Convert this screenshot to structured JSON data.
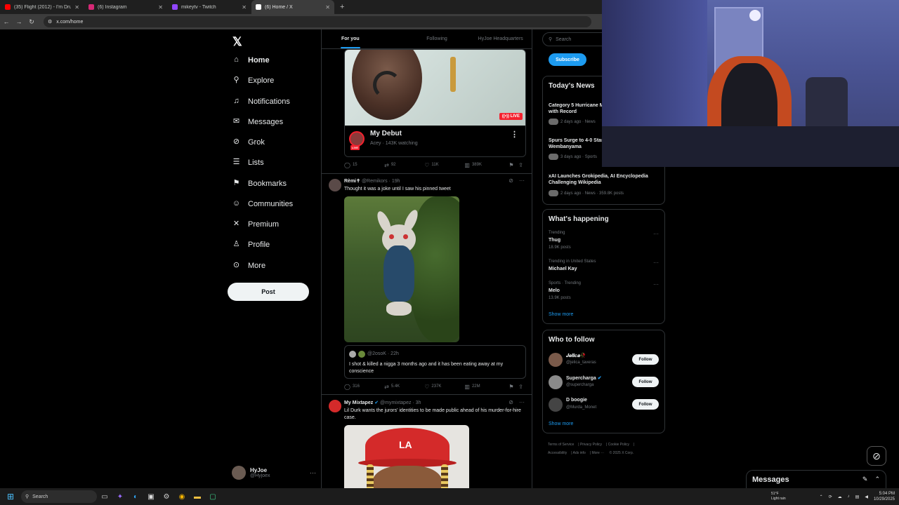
{
  "browser": {
    "tabs": [
      {
        "title": "(35) Flight (2012) - I'm Drunk R",
        "color": "#ff0000"
      },
      {
        "title": "(6) Instagram",
        "color": "#d62976"
      },
      {
        "title": "mikeytv - Twitch",
        "color": "#9146ff"
      },
      {
        "title": "(6) Home / X",
        "color": "#ffffff"
      }
    ],
    "active_tab": 3,
    "url": "x.com/home"
  },
  "nav": {
    "logo": "𝕏",
    "items": [
      {
        "label": "Home",
        "icon": "home-icon"
      },
      {
        "label": "Explore",
        "icon": "search-icon"
      },
      {
        "label": "Notifications",
        "icon": "bell-icon"
      },
      {
        "label": "Messages",
        "icon": "mail-icon"
      },
      {
        "label": "Grok",
        "icon": "grok-icon"
      },
      {
        "label": "Lists",
        "icon": "list-icon"
      },
      {
        "label": "Bookmarks",
        "icon": "bookmark-icon"
      },
      {
        "label": "Communities",
        "icon": "people-icon"
      },
      {
        "label": "Premium",
        "icon": "x-icon"
      },
      {
        "label": "Profile",
        "icon": "person-icon"
      },
      {
        "label": "More",
        "icon": "more-icon"
      }
    ],
    "post_label": "Post",
    "account": {
      "name": "HyJoe",
      "handle": "@Hyjoex"
    }
  },
  "timeline": {
    "tabs": [
      "For you",
      "Following",
      "HyJoe Headquarters"
    ],
    "live": {
      "badge": "LIVE",
      "title": "My Debut",
      "sub": "Acey · 143K watching",
      "avatar_badge": "LIVE",
      "stats": {
        "replies": "15",
        "reposts": "92",
        "likes": "11K",
        "views": "389K"
      }
    },
    "tweet1": {
      "name": "Rèmi✝",
      "meta": "@Remikors · 19h",
      "text": "Thought it was a joke until I saw his pinned tweet",
      "quote": {
        "meta": "@2osoK · 22h",
        "text": "I shot & killed a nigga 3 months ago and it has been eating away at my conscience"
      },
      "stats": {
        "replies": "316",
        "reposts": "5.4K",
        "likes": "237K",
        "views": "22M"
      }
    },
    "tweet2": {
      "name": "My Mixtapez",
      "meta": "@mymixtapez · 3h",
      "text": "Lil Durk wants the jurors' identities to be made public ahead of his murder-for-hire case."
    }
  },
  "sidebar": {
    "search_placeholder": "Search",
    "subscribe": "Subscribe",
    "news": {
      "title": "Today's News",
      "items": [
        {
          "title": "Category 5 Hurricane Melissa Slams Jamaica with Record",
          "meta": "2 days ago · News"
        },
        {
          "title": "Spurs Surge to 4-0 Start Led by Victor Wembanyama",
          "meta": "3 days ago · Sports"
        },
        {
          "title": "xAI Launches Grokipedia, AI Encyclopedia Challenging Wikipedia",
          "meta": "2 days ago · News · 359.8K posts"
        }
      ]
    },
    "happening": {
      "title": "What's happening",
      "items": [
        {
          "cat": "Trending",
          "name": "Thug",
          "count": "18.9K posts"
        },
        {
          "cat": "Trending in United States",
          "name": "Michael Kay",
          "count": ""
        },
        {
          "cat": "Sports · Trending",
          "name": "Melo",
          "count": "13.9K posts"
        }
      ],
      "show_more": "Show more"
    },
    "who_to_follow": {
      "title": "Who to follow",
      "items": [
        {
          "name": "𝑱𝒆𝒍𝒊𝒄𝒂🥀",
          "handle": "@jelica_taveras",
          "button": "Follow"
        },
        {
          "name": "Supercharga",
          "handle": "@supercharga",
          "button": "Follow"
        },
        {
          "name": "D boogie",
          "handle": "@Murda_Monet",
          "button": "Follow"
        }
      ],
      "show_more": "Show more"
    },
    "footer": [
      "Terms of Service",
      "Privacy Policy",
      "Cookie Policy",
      "Accessibility",
      "Ads info",
      "More ···",
      "© 2025 X Corp."
    ]
  },
  "dock": {
    "messages": "Messages"
  },
  "taskbar": {
    "search": "Search",
    "weather_temp": "51°F",
    "weather_desc": "Light rain",
    "time": "5:04 PM",
    "date": "10/29/2025"
  },
  "colors": {
    "accent": "#1d9bf0",
    "live": "#f4212e",
    "bg": "#000000"
  }
}
